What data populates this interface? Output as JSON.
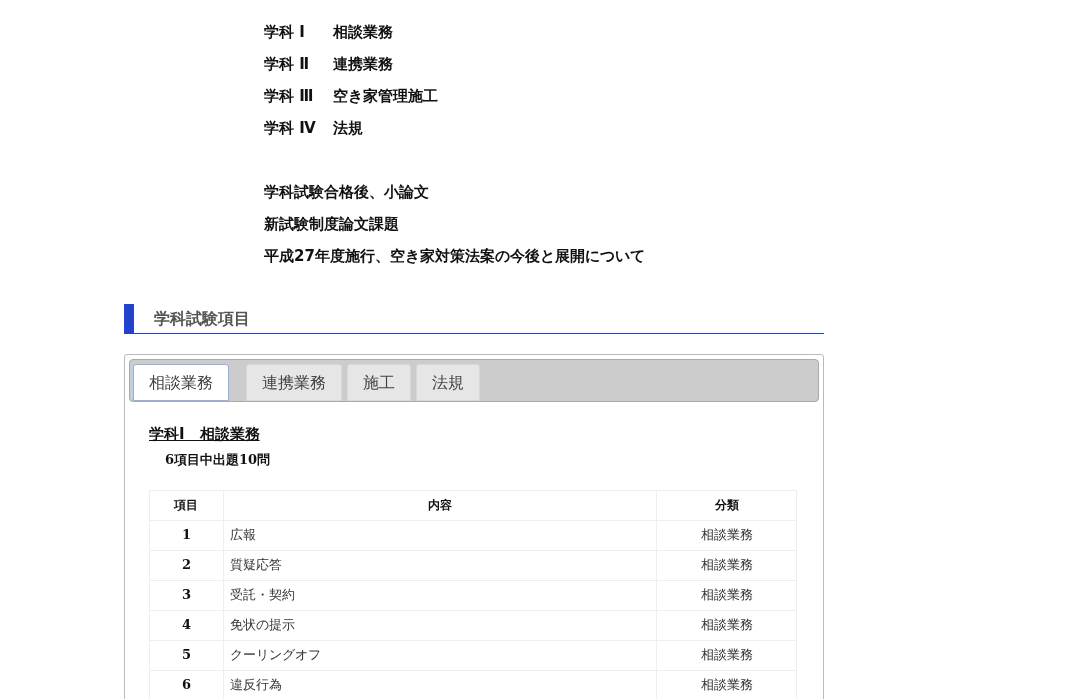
{
  "subjects": [
    {
      "label": "学科 Ⅰ",
      "name": "相談業務"
    },
    {
      "label": "学科 Ⅱ",
      "name": "連携業務"
    },
    {
      "label": "学科 Ⅲ",
      "name": "空き家管理施工"
    },
    {
      "label": "学科 Ⅳ",
      "name": "法規"
    }
  ],
  "essay_lines": [
    "学科試験合格後、小論文",
    "新試験制度論文課題",
    "平成27年度施行、空き家対策法案の今後と展開について"
  ],
  "section_heading": "学科試験項目",
  "tabs": [
    {
      "label": "相談業務",
      "selected": true
    },
    {
      "label": "連携業務",
      "selected": false
    },
    {
      "label": "施工",
      "selected": false
    },
    {
      "label": "法規",
      "selected": false
    }
  ],
  "panel": {
    "title": "学科Ⅰ　相談業務",
    "subtitle": "6項目中出題10問",
    "table": {
      "columns": [
        "項目",
        "内容",
        "分類"
      ],
      "rows": [
        [
          "1",
          "広報",
          "相談業務"
        ],
        [
          "2",
          "質疑応答",
          "相談業務"
        ],
        [
          "3",
          "受託・契約",
          "相談業務"
        ],
        [
          "4",
          "免状の提示",
          "相談業務"
        ],
        [
          "5",
          "クーリングオフ",
          "相談業務"
        ],
        [
          "6",
          "違反行為",
          "相談業務"
        ]
      ]
    }
  }
}
